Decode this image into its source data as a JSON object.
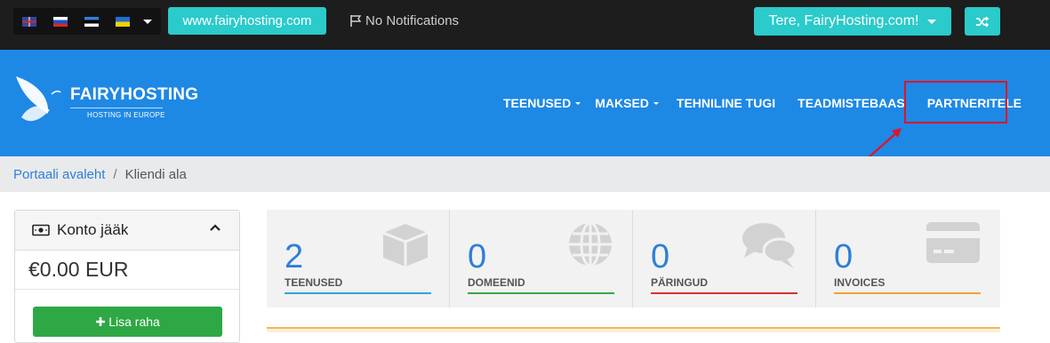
{
  "topbar": {
    "language_flags": [
      "uk-flag-icon",
      "ru-flag-icon",
      "ee-flag-icon",
      "ua-flag-icon"
    ],
    "site_button": "www.fairyhosting.com",
    "notifications": "No Notifications",
    "greeting_button": "Tere, FairyHosting.com!",
    "accent_color": "#2bcacb"
  },
  "header": {
    "logo_name": "FAIRYHOSTING",
    "logo_tagline": "HOSTING IN EUROPE",
    "nav": [
      {
        "label": "TEENUSED",
        "dropdown": true
      },
      {
        "label": "MAKSED",
        "dropdown": true
      },
      {
        "label": "TEHNILINE TUGI",
        "dropdown": false
      },
      {
        "label": "TEADMISTEBAAS",
        "dropdown": false
      },
      {
        "label": "PARTNERITELE",
        "dropdown": false
      }
    ],
    "bg_color": "#1e88e5"
  },
  "breadcrumb": {
    "home": "Portaali avaleht",
    "separator": "/",
    "current": "Kliendi ala"
  },
  "account": {
    "title": "Konto jääk",
    "balance": "€0.00 EUR",
    "add_funds": "Lisa raha"
  },
  "stats": [
    {
      "value": "2",
      "label": "TEENUSED",
      "color": "#36a3dd",
      "icon": "box-icon"
    },
    {
      "value": "0",
      "label": "DOMEENID",
      "color": "#3fa643",
      "icon": "globe-icon"
    },
    {
      "value": "0",
      "label": "PÄRINGUD",
      "color": "#d9322a",
      "icon": "chat-bubbles-icon"
    },
    {
      "value": "0",
      "label": "INVOICES",
      "color": "#f0a335",
      "icon": "credit-card-icon"
    }
  ],
  "annotation_color": "#e0142a"
}
